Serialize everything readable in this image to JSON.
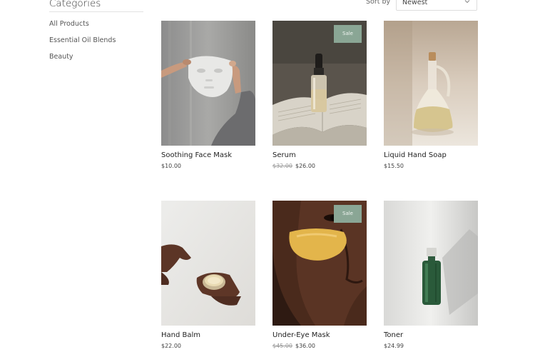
{
  "sidebar": {
    "title": "Categories",
    "items": [
      {
        "label": "All Products"
      },
      {
        "label": "Essential Oil Blends"
      },
      {
        "label": "Beauty"
      }
    ]
  },
  "sort": {
    "label": "Sort by",
    "value": "Newest"
  },
  "products": [
    {
      "name": "Soothing Face Mask",
      "price": "$10.00",
      "old_price": "",
      "sale": false,
      "image": "face-mask-photo"
    },
    {
      "name": "Serum",
      "price": "$26.00",
      "old_price": "$32.00",
      "sale": true,
      "sale_label": "Sale",
      "image": "serum-bottle-photo"
    },
    {
      "name": "Liquid Hand Soap",
      "price": "$15.50",
      "old_price": "",
      "sale": false,
      "image": "hand-soap-photo"
    },
    {
      "name": "Hand Balm",
      "price": "$22.00",
      "old_price": "",
      "sale": false,
      "image": "hand-balm-photo"
    },
    {
      "name": "Under-Eye Mask",
      "price": "$36.00",
      "old_price": "$45.00",
      "sale": true,
      "sale_label": "Sale",
      "image": "under-eye-mask-photo"
    },
    {
      "name": "Toner",
      "price": "$24.99",
      "old_price": "",
      "sale": false,
      "image": "toner-bottle-photo"
    }
  ],
  "colors": {
    "sale_badge": "#8aa695",
    "divider": "#e2e2e2"
  }
}
